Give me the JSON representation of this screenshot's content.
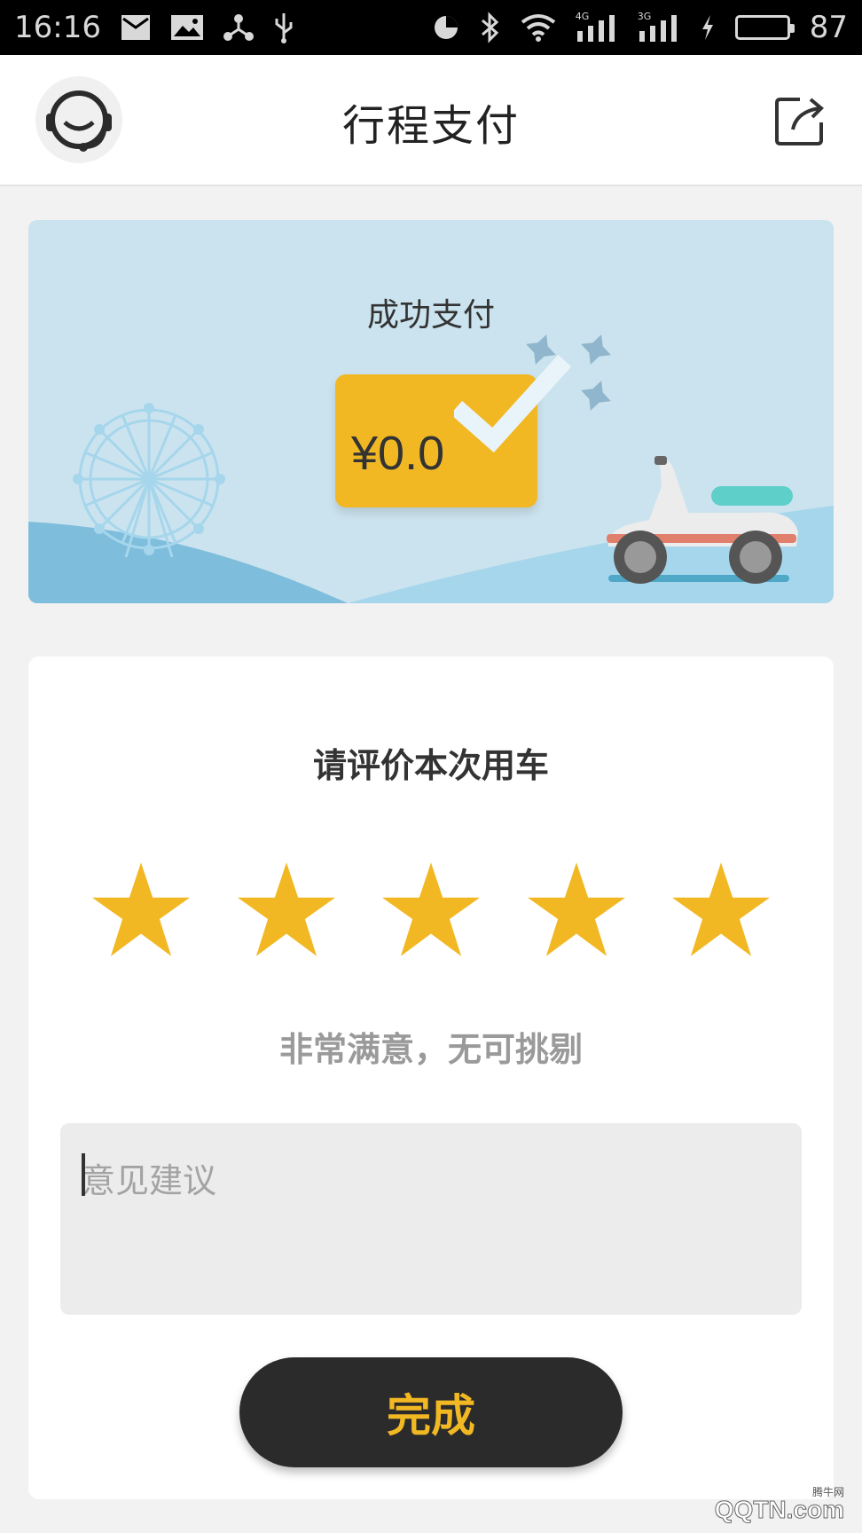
{
  "status_bar": {
    "time": "16:16",
    "network_4g": "4G",
    "network_3g": "3G",
    "battery_level": "87",
    "battery_fraction": 0.87
  },
  "header": {
    "title": "行程支付",
    "left_icon": "customer-service-headset-icon",
    "right_icon": "share-icon"
  },
  "payment": {
    "status": "成功支付",
    "amount": "¥0.0"
  },
  "rating": {
    "title": "请评价本次用车",
    "stars_selected": 5,
    "stars_total": 5,
    "description": "非常满意，无可挑剔",
    "feedback_placeholder": "意见建议",
    "feedback_value": "",
    "submit_label": "完成"
  },
  "colors": {
    "accent_yellow": "#f2b824",
    "button_dark": "#2b2b2b",
    "card_blue": "#cbe3ee"
  },
  "watermark": {
    "text": "QQTN.com",
    "small": "腾牛网"
  }
}
